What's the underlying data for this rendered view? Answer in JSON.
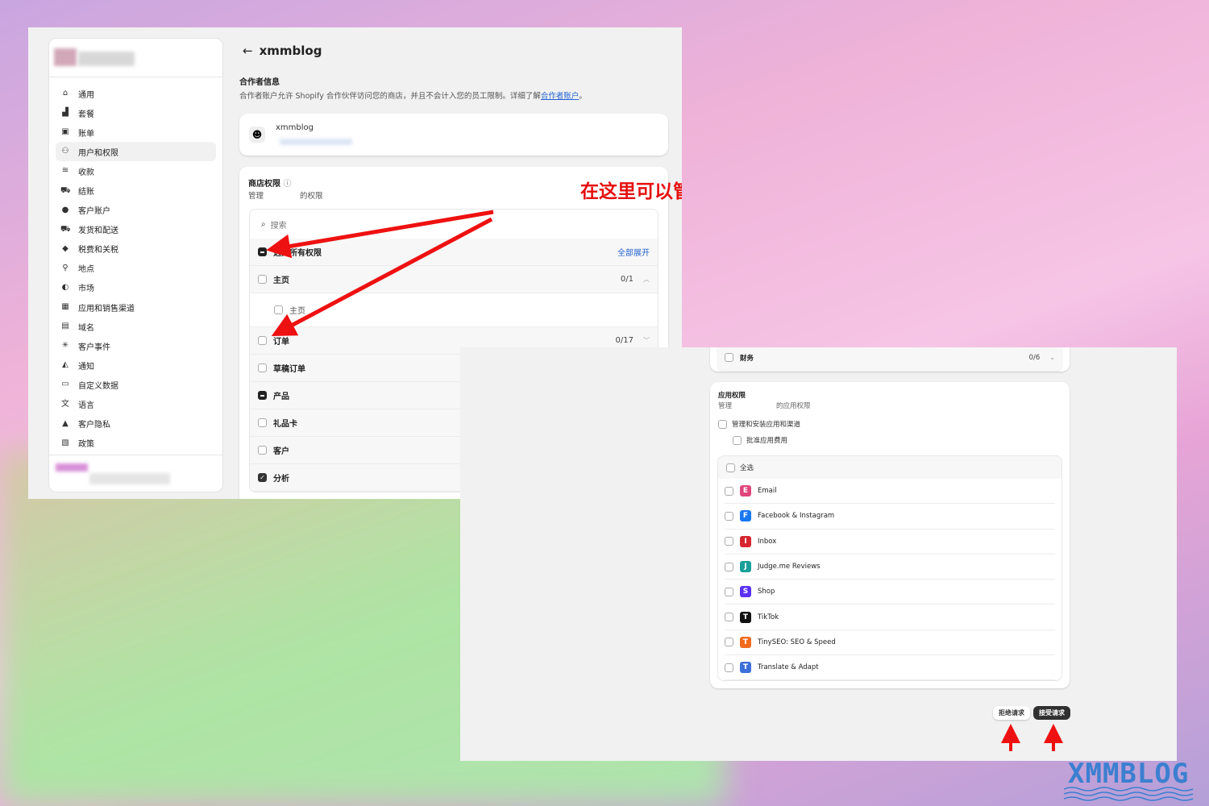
{
  "header": {
    "back_icon": "arrow-left-icon",
    "title": "xmmblog"
  },
  "sidebar": {
    "items": [
      {
        "label": "通用",
        "icon": "store-icon"
      },
      {
        "label": "套餐",
        "icon": "plan-icon"
      },
      {
        "label": "账单",
        "icon": "bill-icon"
      },
      {
        "label": "用户和权限",
        "icon": "users-icon",
        "active": true
      },
      {
        "label": "收款",
        "icon": "payment-icon"
      },
      {
        "label": "结账",
        "icon": "cart-icon"
      },
      {
        "label": "客户账户",
        "icon": "person-icon"
      },
      {
        "label": "发货和配送",
        "icon": "truck-icon"
      },
      {
        "label": "税费和关税",
        "icon": "tax-icon"
      },
      {
        "label": "地点",
        "icon": "location-icon"
      },
      {
        "label": "市场",
        "icon": "globe-icon"
      },
      {
        "label": "应用和销售渠道",
        "icon": "apps-icon"
      },
      {
        "label": "域名",
        "icon": "domain-icon"
      },
      {
        "label": "客户事件",
        "icon": "events-icon"
      },
      {
        "label": "通知",
        "icon": "bell-icon"
      },
      {
        "label": "自定义数据",
        "icon": "data-icon"
      },
      {
        "label": "语言",
        "icon": "language-icon"
      },
      {
        "label": "客户隐私",
        "icon": "lock-icon"
      },
      {
        "label": "政策",
        "icon": "policy-icon"
      }
    ]
  },
  "collaborator": {
    "heading": "合作者信息",
    "desc": "合作者账户允许 Shopify 合作伙伴访问您的商店，并且不会计入您的员工限制。详细了解",
    "link": "合作者账户",
    "period": "。",
    "name": "xmmblog"
  },
  "store_permissions": {
    "heading": "商店权限",
    "sub_prefix": "管理",
    "sub_suffix": "的权限",
    "search_placeholder": "搜索",
    "select_all": "选择所有权限",
    "expand_all": "全部展开",
    "rows": [
      {
        "label": "主页",
        "count": "0/1",
        "state": "empty",
        "chevron": "up"
      },
      {
        "label": "主页",
        "sub": true,
        "state": "empty"
      },
      {
        "label": "订单",
        "count": "0/17",
        "state": "empty",
        "chevron": "down"
      },
      {
        "label": "草稿订单",
        "state": "empty"
      },
      {
        "label": "产品",
        "state": "partial"
      },
      {
        "label": "礼品卡",
        "state": "empty"
      },
      {
        "label": "客户",
        "state": "empty"
      },
      {
        "label": "分析",
        "state": "checked"
      }
    ]
  },
  "annotation": "在这里可以管理合作者账户的权限",
  "finance_row": {
    "label": "财务",
    "count": "0/6"
  },
  "app_permissions": {
    "heading": "应用权限",
    "sub_prefix": "管理",
    "sub_suffix": "的应用权限",
    "manage": "管理和安装应用和渠道",
    "approve": "批准应用费用",
    "select_all": "全选",
    "apps": [
      {
        "name": "Email",
        "color": "#e0457b"
      },
      {
        "name": "Facebook & Instagram",
        "color": "#1877f2"
      },
      {
        "name": "Inbox",
        "color": "#d6262f"
      },
      {
        "name": "Judge.me Reviews",
        "color": "#1a9f9a"
      },
      {
        "name": "Shop",
        "color": "#5a31f4"
      },
      {
        "name": "TikTok",
        "color": "#111111"
      },
      {
        "name": "TinySEO: SEO & Speed",
        "color": "#f26b1d"
      },
      {
        "name": "Translate & Adapt",
        "color": "#3d6fd8"
      }
    ]
  },
  "actions": {
    "decline": "拒绝请求",
    "accept": "接受请求"
  },
  "watermark": "XMMBLOG",
  "colors": {
    "annotation": "#e50f0f",
    "link": "#2463d1",
    "primary_button": "#303030"
  }
}
